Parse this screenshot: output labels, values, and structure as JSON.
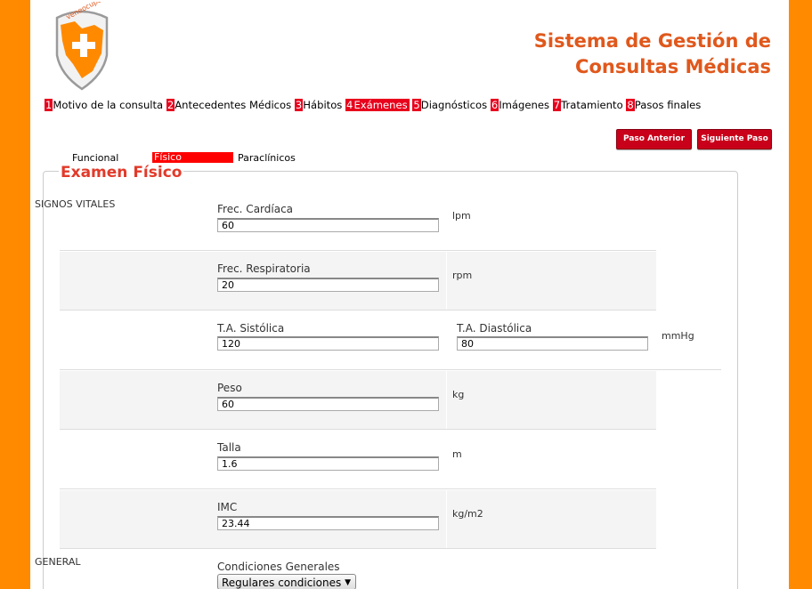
{
  "header": {
    "logo_text": "veneocupacional",
    "title_line1": "Sistema de Gestión de",
    "title_line2": "Consultas Médicas"
  },
  "steps": [
    {
      "num": "1",
      "label": "Motivo de la consulta"
    },
    {
      "num": "2",
      "label": "Antecedentes Médicos"
    },
    {
      "num": "3",
      "label": "Hábitos"
    },
    {
      "num": "4",
      "label": "Exámenes"
    },
    {
      "num": "5",
      "label": "Diagnósticos"
    },
    {
      "num": "6",
      "label": "Imágenes"
    },
    {
      "num": "7",
      "label": "Tratamiento"
    },
    {
      "num": "8",
      "label": "Pasos finales"
    }
  ],
  "nav": {
    "prev_label": "Paso Anterior",
    "next_label": "Siguiente Paso"
  },
  "subtabs": {
    "funcional": "Funcional",
    "fisico": "Físico",
    "paraclinicos": "Paraclínicos"
  },
  "section_title": "Examen Físico",
  "sections": {
    "vital_signs": "SIGNOS VITALES",
    "general": "GENERAL"
  },
  "fields": {
    "frec_cardiaca": {
      "label": "Frec. Cardíaca",
      "value": "60",
      "unit": "lpm"
    },
    "frec_respiratoria": {
      "label": "Frec. Respiratoria",
      "value": "20",
      "unit": "rpm"
    },
    "ta_sistolica": {
      "label": "T.A. Sistólica",
      "value": "120"
    },
    "ta_diastolica": {
      "label": "T.A. Diastólica",
      "value": "80",
      "unit": "mmHg"
    },
    "peso": {
      "label": "Peso",
      "value": "60",
      "unit": "kg"
    },
    "talla": {
      "label": "Talla",
      "value": "1.6",
      "unit": "m"
    },
    "imc": {
      "label": "IMC",
      "value": "23.44",
      "unit": "kg/m2"
    },
    "condiciones": {
      "label": "Condiciones Generales",
      "value": "Regulares condiciones"
    }
  },
  "colors": {
    "accent": "#e8001c",
    "brand_orange": "#ff8a00",
    "title_orange": "#e0581c"
  }
}
